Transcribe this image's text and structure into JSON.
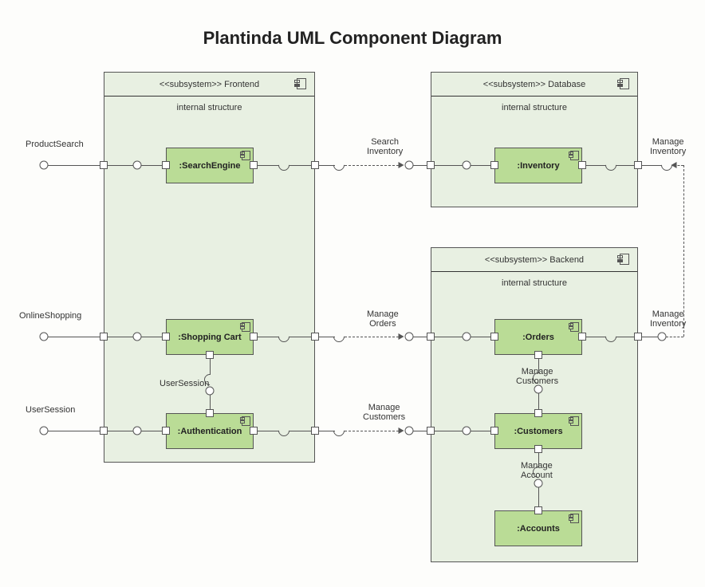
{
  "title": "Plantinda UML Component Diagram",
  "subsystems": {
    "frontend": {
      "stereotype": "<<subsystem>> Frontend",
      "sub": "internal structure"
    },
    "database": {
      "stereotype": "<<subsystem>> Database",
      "sub": "internal structure"
    },
    "backend": {
      "stereotype": "<<subsystem>> Backend",
      "sub": "internal structure"
    }
  },
  "components": {
    "searchEngine": ":SearchEngine",
    "shoppingCart": ":Shopping Cart",
    "authentication": ":Authentication",
    "inventory": ":Inventory",
    "orders": ":Orders",
    "customers": ":Customers",
    "accounts": ":Accounts"
  },
  "interfaces": {
    "productSearch": "ProductSearch",
    "onlineShopping": "OnlineShopping",
    "userSession": "UserSession",
    "userSessionInt": "UserSession",
    "searchInventory": "Search\nInventory",
    "manageInventoryDB": "Manage\nInventory",
    "manageOrders": "Manage\nOrders",
    "manageCustomers": "Manage\nCustomers",
    "manageCustomersInt": "Manage\nCustomers",
    "manageAccount": "Manage\nAccount",
    "manageInventoryBE": "Manage\nInventory"
  }
}
